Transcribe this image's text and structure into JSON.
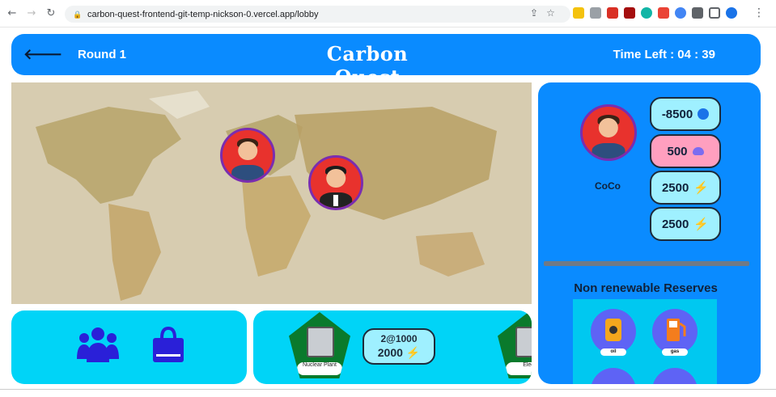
{
  "browser": {
    "url": "carbon-quest-frontend-git-temp-nickson-0.vercel.app/lobby"
  },
  "header": {
    "round_label": "Round 1",
    "title": "Carbon Quest",
    "time_left": "Time Left : 04 : 39"
  },
  "trade": {
    "card_label": "Nuclear Plant",
    "price_line": "2@1000",
    "energy_value": "2000",
    "next_card_label": "Elec"
  },
  "player": {
    "name": "CoCo",
    "money": "-8500",
    "carbon": "500",
    "energy_1": "2500",
    "energy_2": "2500"
  },
  "reserves": {
    "title": "Non renewable Reserves",
    "items": [
      "oil",
      "gas"
    ]
  },
  "colors": {
    "header_blue": "#0a8bff",
    "panel_cyan": "#00d4f7",
    "stat_money": "#9ff0ff",
    "stat_carbon": "#ff9fbf",
    "avatar_border": "#7a2db0"
  }
}
